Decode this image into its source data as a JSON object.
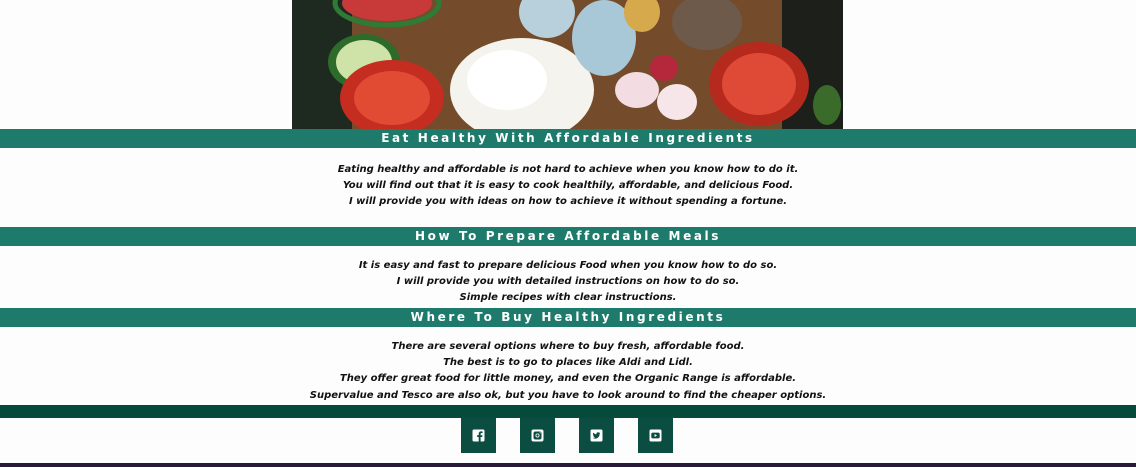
{
  "hero": {
    "image_name": "healthy-ingredients-photo"
  },
  "sections": [
    {
      "title": "Eat Healthy With Affordable Ingredients",
      "lines": [
        "Eating healthy and affordable is not hard to achieve when you know how to do it.",
        "You will find out that it is easy to cook healthily, affordable, and delicious Food.",
        "I will provide you with ideas on how to achieve it without spending a fortune."
      ]
    },
    {
      "title": "How To Prepare Affordable Meals",
      "lines": [
        "It is easy and fast to prepare delicious Food when you know how to do so.",
        "I will provide you with detailed instructions on how to do so.",
        "Simple recipes with clear instructions."
      ]
    },
    {
      "title": "Where To Buy Healthy Ingredients",
      "lines": [
        "There are several options where to buy fresh, affordable food.",
        "The best is to go to places like Aldi and Lidl.",
        "They offer great food for little money, and even the Organic Range is affordable.",
        "Supervalue and Tesco are also ok, but you have to look around to find the cheaper options."
      ]
    }
  ],
  "footer": {
    "social": [
      "facebook-icon",
      "instagram-icon",
      "twitter-icon",
      "youtube-icon"
    ]
  },
  "colors": {
    "band": "#1e7b6c",
    "footer": "#064a3c",
    "social_bg": "#0b4d40"
  }
}
